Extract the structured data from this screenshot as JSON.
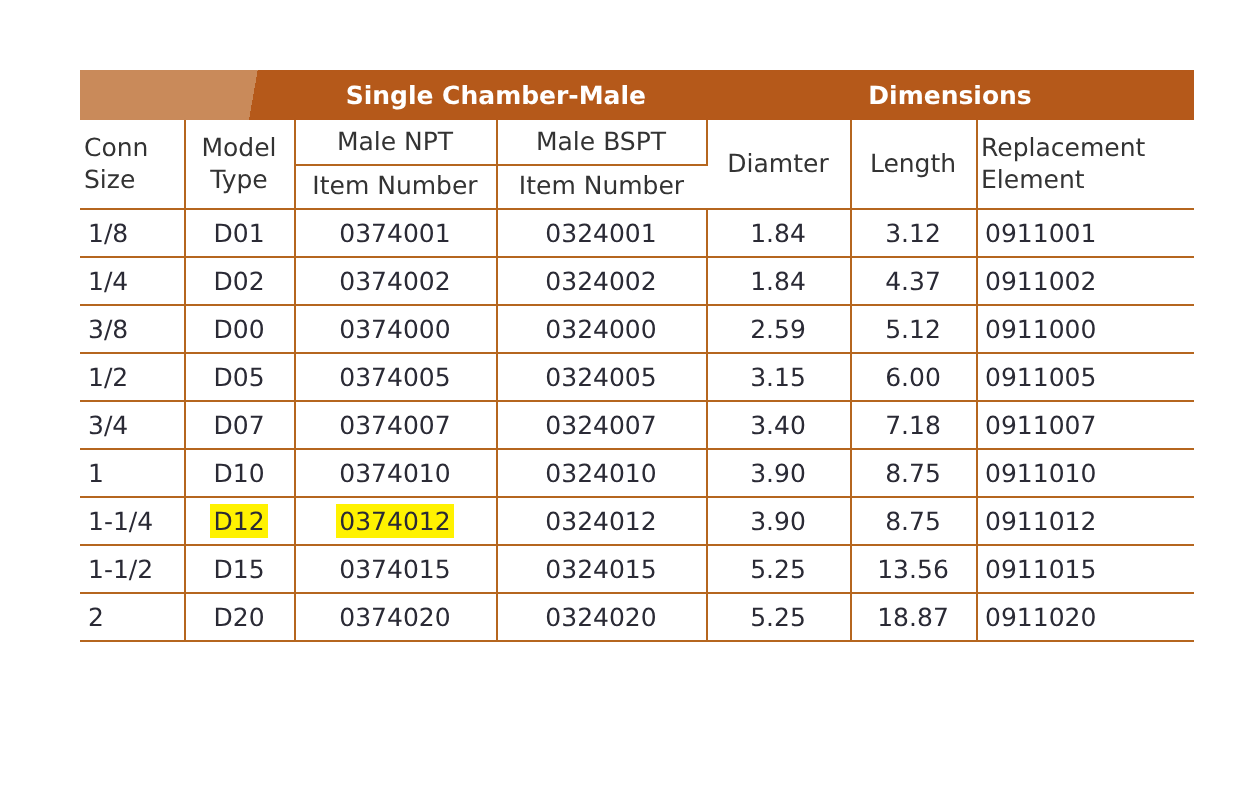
{
  "table": {
    "groups": [
      {
        "label": "Single Chamber-Male",
        "columns": [
          {
            "label": "Conn Size"
          },
          {
            "label": "Model Type"
          },
          {
            "label": "Male NPT",
            "sub": "Item Number"
          },
          {
            "label": "Male BSPT",
            "sub": "Item Number"
          }
        ]
      },
      {
        "label": "Dimensions",
        "columns": [
          {
            "label": "Diamter"
          },
          {
            "label": "Length"
          },
          {
            "label": "Replacement Element"
          }
        ]
      }
    ],
    "rows": [
      [
        {
          "text": "1/8",
          "highlighted": false
        },
        {
          "text": "D01",
          "highlighted": false
        },
        {
          "text": "0374001",
          "highlighted": false
        },
        {
          "text": "0324001",
          "highlighted": false
        },
        {
          "text": "1.84",
          "highlighted": false
        },
        {
          "text": "3.12",
          "highlighted": false
        },
        {
          "text": "0911001",
          "highlighted": false
        }
      ],
      [
        {
          "text": "1/4",
          "highlighted": false
        },
        {
          "text": "D02",
          "highlighted": false
        },
        {
          "text": "0374002",
          "highlighted": false
        },
        {
          "text": "0324002",
          "highlighted": false
        },
        {
          "text": "1.84",
          "highlighted": false
        },
        {
          "text": "4.37",
          "highlighted": false
        },
        {
          "text": "0911002",
          "highlighted": false
        }
      ],
      [
        {
          "text": "3/8",
          "highlighted": false
        },
        {
          "text": "D00",
          "highlighted": false
        },
        {
          "text": "0374000",
          "highlighted": false
        },
        {
          "text": "0324000",
          "highlighted": false
        },
        {
          "text": "2.59",
          "highlighted": false
        },
        {
          "text": "5.12",
          "highlighted": false
        },
        {
          "text": "0911000",
          "highlighted": false
        }
      ],
      [
        {
          "text": "1/2",
          "highlighted": false
        },
        {
          "text": "D05",
          "highlighted": false
        },
        {
          "text": "0374005",
          "highlighted": false
        },
        {
          "text": "0324005",
          "highlighted": false
        },
        {
          "text": "3.15",
          "highlighted": false
        },
        {
          "text": "6.00",
          "highlighted": false
        },
        {
          "text": "0911005",
          "highlighted": false
        }
      ],
      [
        {
          "text": "3/4",
          "highlighted": false
        },
        {
          "text": "D07",
          "highlighted": false
        },
        {
          "text": "0374007",
          "highlighted": false
        },
        {
          "text": "0324007",
          "highlighted": false
        },
        {
          "text": "3.40",
          "highlighted": false
        },
        {
          "text": "7.18",
          "highlighted": false
        },
        {
          "text": "0911007",
          "highlighted": false
        }
      ],
      [
        {
          "text": "1",
          "highlighted": false
        },
        {
          "text": "D10",
          "highlighted": false
        },
        {
          "text": "0374010",
          "highlighted": false
        },
        {
          "text": "0324010",
          "highlighted": false
        },
        {
          "text": "3.90",
          "highlighted": false
        },
        {
          "text": "8.75",
          "highlighted": false
        },
        {
          "text": "0911010",
          "highlighted": false
        }
      ],
      [
        {
          "text": "1-1/4",
          "highlighted": false
        },
        {
          "text": "D12",
          "highlighted": true
        },
        {
          "text": "0374012",
          "highlighted": true
        },
        {
          "text": "0324012",
          "highlighted": false
        },
        {
          "text": "3.90",
          "highlighted": false
        },
        {
          "text": "8.75",
          "highlighted": false
        },
        {
          "text": "0911012",
          "highlighted": false
        }
      ],
      [
        {
          "text": "1-1/2",
          "highlighted": false
        },
        {
          "text": "D15",
          "highlighted": false
        },
        {
          "text": "0374015",
          "highlighted": false
        },
        {
          "text": "0324015",
          "highlighted": false
        },
        {
          "text": "5.25",
          "highlighted": false
        },
        {
          "text": "13.56",
          "highlighted": false
        },
        {
          "text": "0911015",
          "highlighted": false
        }
      ],
      [
        {
          "text": "2",
          "highlighted": false
        },
        {
          "text": "D20",
          "highlighted": false
        },
        {
          "text": "0374020",
          "highlighted": false
        },
        {
          "text": "0324020",
          "highlighted": false
        },
        {
          "text": "5.25",
          "highlighted": false
        },
        {
          "text": "18.87",
          "highlighted": false
        },
        {
          "text": "0911020",
          "highlighted": false
        }
      ]
    ]
  }
}
